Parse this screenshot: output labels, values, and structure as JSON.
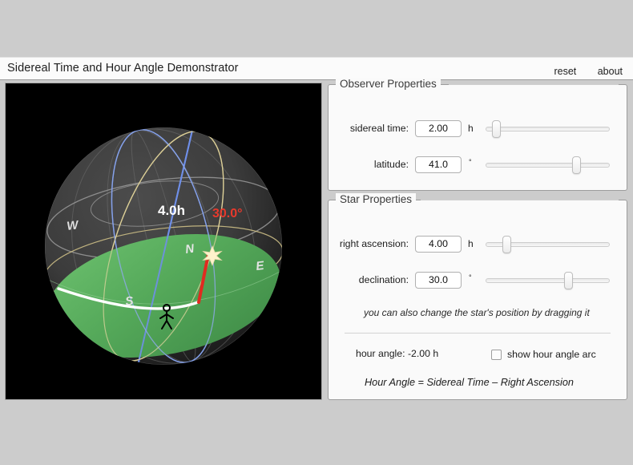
{
  "header": {
    "title": "Sidereal Time and Hour Angle Demonstrator",
    "reset_label": "reset",
    "about_label": "about"
  },
  "observer": {
    "legend": "Observer Properties",
    "sidereal_time": {
      "label": "sidereal time:",
      "value": "2.00",
      "unit": "h",
      "slider_percent": 8.3
    },
    "latitude": {
      "label": "latitude:",
      "value": "41.0",
      "unit": "°",
      "slider_percent": 72.8
    }
  },
  "star": {
    "legend": "Star Properties",
    "right_ascension": {
      "label": "right ascension:",
      "value": "4.00",
      "unit": "h",
      "slider_percent": 16.7
    },
    "declination": {
      "label": "declination:",
      "value": "30.0",
      "unit": "°",
      "slider_percent": 66.7
    },
    "hint": "you can also change the star's position by dragging it",
    "hour_angle_text": "hour angle:  -2.00 h",
    "show_arc_label": "show hour angle arc",
    "show_arc_checked": false,
    "formula": "Hour Angle  =  Sidereal Time  –  Right Ascension"
  },
  "sphere": {
    "hour_angle_label": "4.0h",
    "declination_label": "30.0°",
    "compass_n": "N",
    "compass_e": "E",
    "compass_s": "S",
    "compass_w": "W",
    "colors": {
      "horizon_plane": "#4fa355",
      "sphere_dark": "#3a3a3a",
      "declination_arc": "#e02b20",
      "hour_angle_arc": "#ffffff",
      "ecliptic": "#d8c98a",
      "axis": "#6f8fe8",
      "grid": "#8d8d8d",
      "star": "#fff3cc",
      "background": "#000000"
    }
  }
}
